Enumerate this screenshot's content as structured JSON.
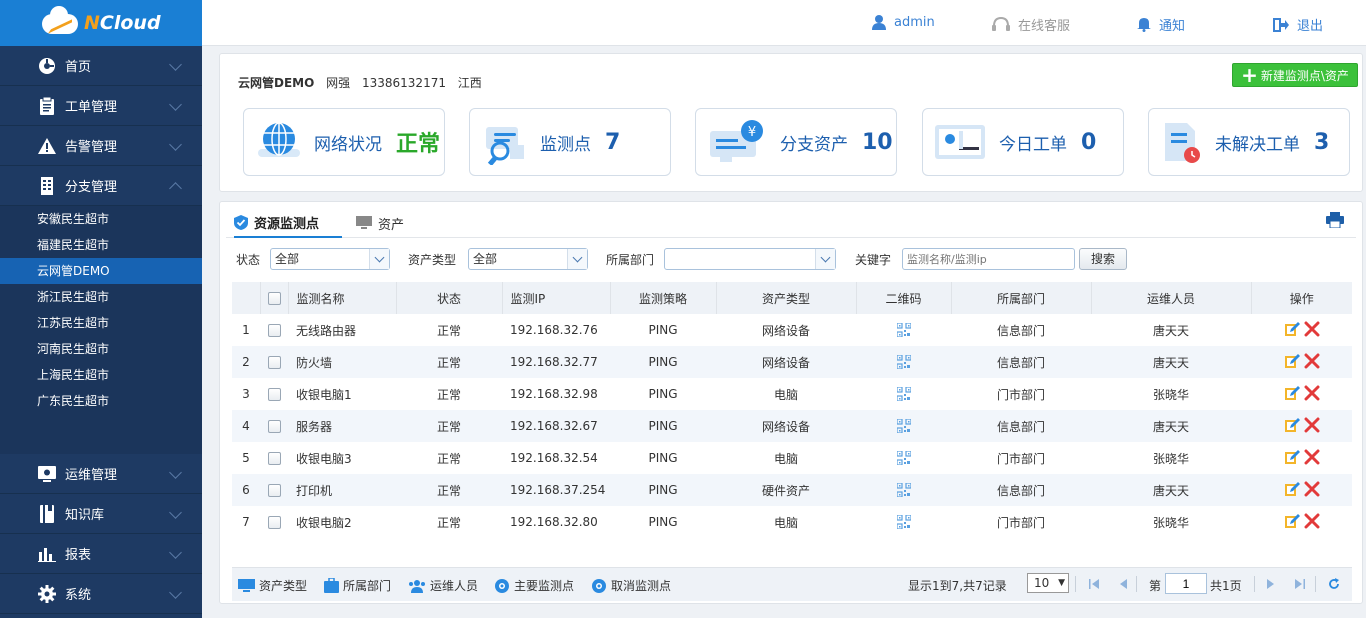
{
  "app": {
    "brand_n": "N",
    "brand_rest": "Cloud"
  },
  "colors": {
    "sidebar": "#1e3a63",
    "accent": "#1a7fd4",
    "ok": "#2aa82a",
    "link": "#3b82d4",
    "green_button": "#3cc13b"
  },
  "sidebar": {
    "items_top": [
      {
        "label": "首页",
        "icon": "dashboard-icon"
      },
      {
        "label": "工单管理",
        "icon": "clipboard-icon"
      },
      {
        "label": "告警管理",
        "icon": "warning-icon"
      },
      {
        "label": "分支管理",
        "icon": "building-icon"
      }
    ],
    "branches": [
      "安徽民生超市",
      "福建民生超市",
      "云网管DEMO",
      "浙江民生超市",
      "江苏民生超市",
      "河南民生超市",
      "上海民生超市",
      "广东民生超市"
    ],
    "active_branch": "云网管DEMO",
    "items_bottom": [
      {
        "label": "运维管理",
        "icon": "ops-icon"
      },
      {
        "label": "知识库",
        "icon": "book-icon"
      },
      {
        "label": "报表",
        "icon": "chart-icon"
      },
      {
        "label": "系统",
        "icon": "gear-icon"
      }
    ]
  },
  "topbar": {
    "user": "admin",
    "support": "在线客服",
    "notify": "通知",
    "logout": "退出"
  },
  "summary": {
    "org": "云网管DEMO",
    "contact": "网强",
    "phone": "13386132171",
    "region": "江西",
    "new_button": "新建监测点\\资产",
    "cards": [
      {
        "label": "网络状况",
        "value": "正常"
      },
      {
        "label": "监测点",
        "value": "7"
      },
      {
        "label": "分支资产",
        "value": "10"
      },
      {
        "label": "今日工单",
        "value": "0"
      },
      {
        "label": "未解决工单",
        "value": "3"
      }
    ]
  },
  "tabs": {
    "monitor": "资源监测点",
    "asset": "资产"
  },
  "filters": {
    "status_label": "状态",
    "status_value": "全部",
    "type_label": "资产类型",
    "type_value": "全部",
    "dept_label": "所属部门",
    "dept_value": "",
    "keyword_label": "关键字",
    "keyword_placeholder": "监测名称/监测ip",
    "search_button": "搜索"
  },
  "table": {
    "headers": {
      "name": "监测名称",
      "status": "状态",
      "ip": "监测IP",
      "policy": "监测策略",
      "type": "资产类型",
      "qr": "二维码",
      "dept": "所属部门",
      "owner": "运维人员",
      "ops": "操作"
    },
    "rows": [
      {
        "no": "1",
        "name": "无线路由器",
        "status": "正常",
        "ip": "192.168.32.76",
        "policy": "PING",
        "type": "网络设备",
        "dept": "信息部门",
        "owner": "唐天天"
      },
      {
        "no": "2",
        "name": "防火墙",
        "status": "正常",
        "ip": "192.168.32.77",
        "policy": "PING",
        "type": "网络设备",
        "dept": "信息部门",
        "owner": "唐天天"
      },
      {
        "no": "3",
        "name": "收银电脑1",
        "status": "正常",
        "ip": "192.168.32.98",
        "policy": "PING",
        "type": "电脑",
        "dept": "门市部门",
        "owner": "张晓华"
      },
      {
        "no": "4",
        "name": "服务器",
        "status": "正常",
        "ip": "192.168.32.67",
        "policy": "PING",
        "type": "网络设备",
        "dept": "信息部门",
        "owner": "唐天天"
      },
      {
        "no": "5",
        "name": "收银电脑3",
        "status": "正常",
        "ip": "192.168.32.54",
        "policy": "PING",
        "type": "电脑",
        "dept": "门市部门",
        "owner": "张晓华"
      },
      {
        "no": "6",
        "name": "打印机",
        "status": "正常",
        "ip": "192.168.37.254",
        "policy": "PING",
        "type": "硬件资产",
        "dept": "信息部门",
        "owner": "唐天天"
      },
      {
        "no": "7",
        "name": "收银电脑2",
        "status": "正常",
        "ip": "192.168.32.80",
        "policy": "PING",
        "type": "电脑",
        "dept": "门市部门",
        "owner": "张晓华"
      }
    ]
  },
  "footer": {
    "asset_type": "资产类型",
    "dept": "所属部门",
    "owner": "运维人员",
    "main": "主要监测点",
    "cancel": "取消监测点",
    "records": "显示1到7,共7记录",
    "page_size": "10",
    "page_prefix": "第",
    "page_value": "1",
    "page_suffix": "共1页"
  }
}
